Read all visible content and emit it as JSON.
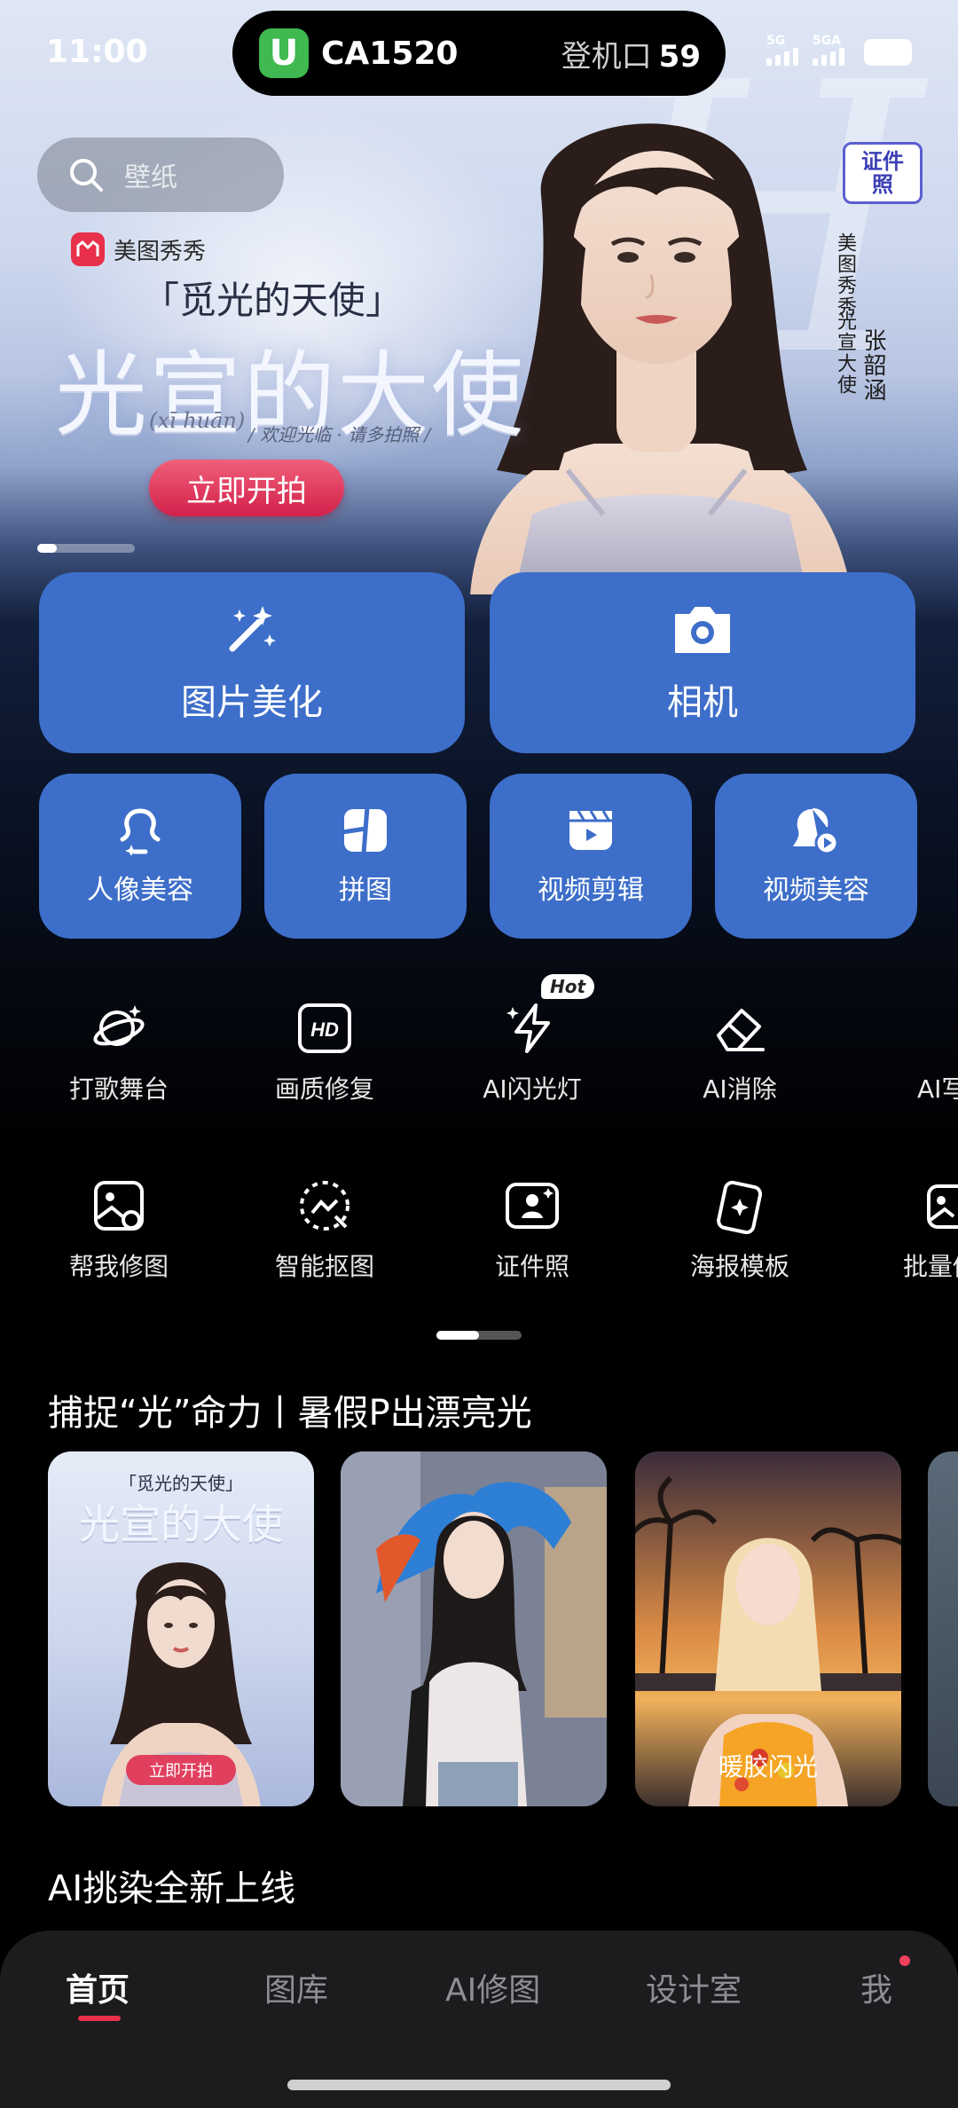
{
  "status_bar": {
    "time": "11:00",
    "island": {
      "app_icon": "U",
      "flight": "CA1520",
      "gate_label": "登机口",
      "gate_number": "59"
    },
    "signal1_label": "5G",
    "signal2_label": "5GA"
  },
  "search": {
    "placeholder": "壁纸"
  },
  "banner": {
    "brand": "美图秀秀",
    "headline_small": "「觅光的天使」",
    "headline_big": "光宣的大使",
    "pinyin": "(xī huān)",
    "tagline": "/ 欢迎光临 · 请多拍照 /",
    "cta": "立即开拍",
    "id_badge_line1": "证件",
    "id_badge_line2": "照",
    "vertical_text_1": "美图秀秀",
    "vertical_text_2": "光宣大使",
    "vertical_text_3": "张韶涵"
  },
  "primary_tools": [
    {
      "label": "图片美化",
      "icon": "magic-wand-icon"
    },
    {
      "label": "相机",
      "icon": "camera-icon"
    }
  ],
  "secondary_tools": [
    {
      "label": "人像美容",
      "icon": "portrait-icon"
    },
    {
      "label": "拼图",
      "icon": "collage-icon"
    },
    {
      "label": "视频剪辑",
      "icon": "video-edit-icon"
    },
    {
      "label": "视频美容",
      "icon": "video-beauty-icon"
    }
  ],
  "tools_row1": [
    {
      "label": "打歌舞台",
      "icon": "stage-icon"
    },
    {
      "label": "画质修复",
      "icon": "hd-icon"
    },
    {
      "label": "AI闪光灯",
      "icon": "flash-icon",
      "badge": "Hot"
    },
    {
      "label": "AI消除",
      "icon": "eraser-icon"
    },
    {
      "label": "AI写",
      "icon": "ai-write-icon"
    }
  ],
  "tools_row2": [
    {
      "label": "帮我修图",
      "icon": "retouch-icon"
    },
    {
      "label": "智能抠图",
      "icon": "cutout-icon"
    },
    {
      "label": "证件照",
      "icon": "id-photo-icon"
    },
    {
      "label": "海报模板",
      "icon": "poster-icon"
    },
    {
      "label": "批量修",
      "icon": "batch-icon"
    }
  ],
  "section1": {
    "title": "捕捉“光”命力丨暑假P出漂亮光",
    "cards": [
      {
        "headline_small": "「觅光的天使」",
        "headline_big": "光宣的大使",
        "button": "立即开拍"
      },
      {
        "label": ""
      },
      {
        "label": "暖胶闪光"
      }
    ]
  },
  "section2": {
    "title": "AI挑染全新上线"
  },
  "bottom_nav": {
    "items": [
      "首页",
      "图库",
      "AI修图",
      "设计室",
      "我"
    ],
    "active": "首页"
  },
  "colors": {
    "card_blue": "#3d6ec9",
    "accent_red": "#e8304a"
  }
}
